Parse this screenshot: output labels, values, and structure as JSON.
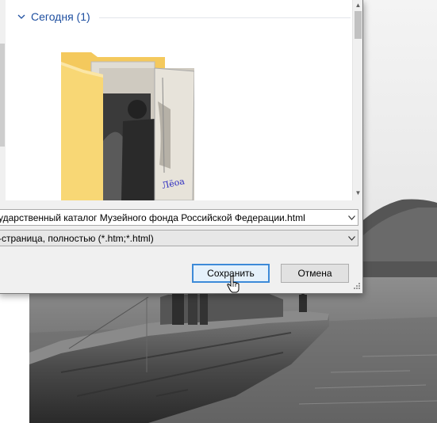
{
  "dialog": {
    "group_header": "Сегодня (1)",
    "file_name": "ударственный каталог Музейного фонда Российской Федерации.html",
    "file_type": "-страница, полностью (*.htm;*.html)",
    "save_label": "Сохранить",
    "cancel_label": "Отмена"
  },
  "icons": {
    "group": "chevron-down-icon",
    "folder": "folder-thumbnail-icon",
    "dropdown": "chevron-down-icon",
    "cursor": "hand-pointer-icon"
  },
  "colors": {
    "group_header": "#1e4fa0",
    "save_border": "#3c8ad8",
    "save_bg": "#e5f1fb",
    "folder": "#f8d775"
  }
}
